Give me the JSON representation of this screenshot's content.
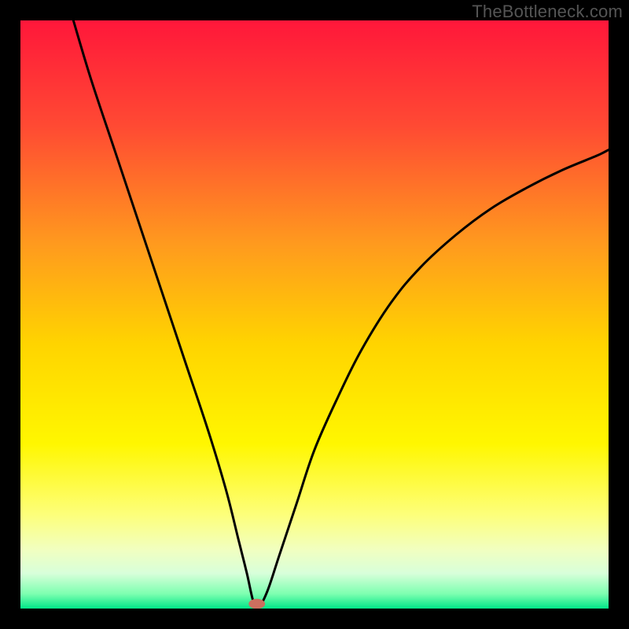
{
  "watermark": "TheBottleneck.com",
  "chart_data": {
    "type": "line",
    "title": "",
    "xlabel": "",
    "ylabel": "",
    "xlim": [
      0,
      100
    ],
    "ylim": [
      0,
      100
    ],
    "grid": false,
    "legend": false,
    "background_gradient": {
      "stops": [
        {
          "offset": 0.0,
          "color": "#ff173a"
        },
        {
          "offset": 0.18,
          "color": "#ff4a33"
        },
        {
          "offset": 0.38,
          "color": "#ff9a1e"
        },
        {
          "offset": 0.55,
          "color": "#ffd400"
        },
        {
          "offset": 0.72,
          "color": "#fff700"
        },
        {
          "offset": 0.84,
          "color": "#fdff7a"
        },
        {
          "offset": 0.9,
          "color": "#f1ffc0"
        },
        {
          "offset": 0.94,
          "color": "#d8ffda"
        },
        {
          "offset": 0.975,
          "color": "#7dffb0"
        },
        {
          "offset": 1.0,
          "color": "#00e688"
        }
      ]
    },
    "series": [
      {
        "name": "bottleneck-curve",
        "x": [
          9,
          12,
          16,
          20,
          24,
          28,
          32,
          35,
          37,
          38.5,
          39.6,
          40.5,
          42,
          44,
          47,
          50,
          54,
          58,
          63,
          68,
          74,
          80,
          86,
          92,
          98,
          100
        ],
        "y": [
          100,
          90,
          78,
          66,
          54,
          42,
          30,
          20,
          12,
          6,
          1.2,
          0.2,
          3,
          9,
          18,
          27,
          36,
          44,
          52,
          58,
          63.5,
          68,
          71.5,
          74.5,
          77,
          78
        ]
      }
    ],
    "marker": {
      "name": "optimal-point",
      "x": 40.2,
      "y": 0.8,
      "color": "#cc6f5f",
      "rx": 1.4,
      "ry": 0.85
    }
  }
}
